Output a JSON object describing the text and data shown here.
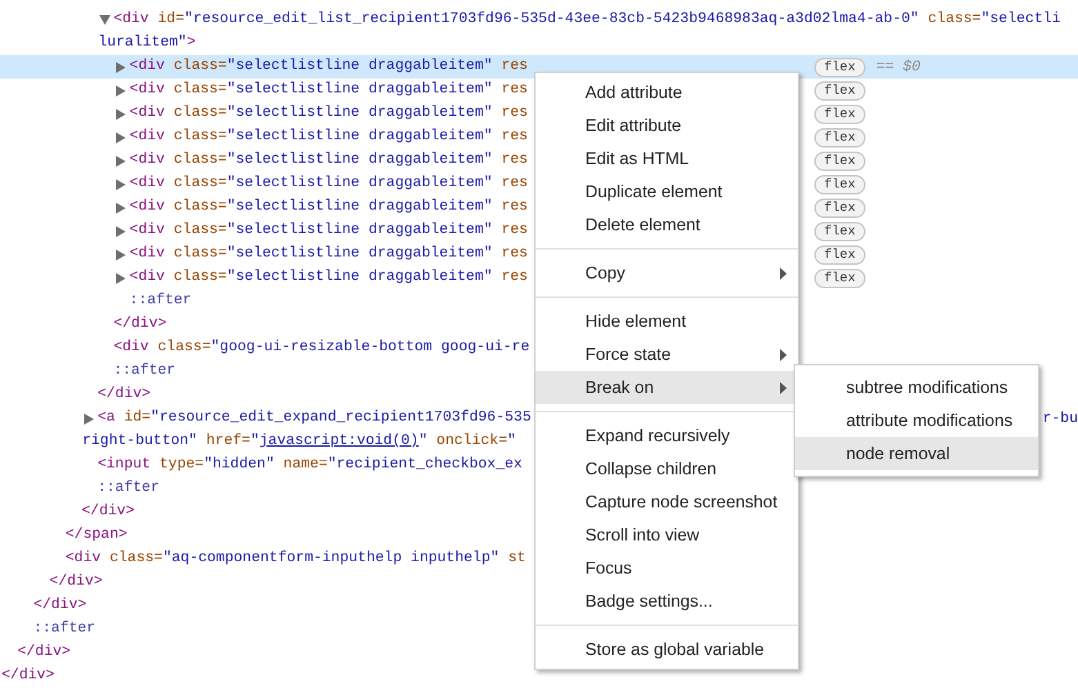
{
  "dom_tree": [
    {
      "children": [
        {
          "children": [
            {
              "children": [
                {
                  "children": [
                    {
                      "children": [
                        {
                          "children": [
                            {
                              "children": [
                                {
                                  "tokens": [
                                    {
                                      "kind": "tag",
                                      "text": "<div"
                                    },
                                    {
                                      "kind": "attr",
                                      "text": " id="
                                    },
                                    {
                                      "kind": "value",
                                      "text": "\"resource_edit_list_recipient1703fd96-535d-43ee-83cb-5423b9468983aq-a3d02lma4-ab-0\""
                                    },
                                    {
                                      "kind": "attr",
                                      "text": " class="
                                    },
                                    {
                                      "kind": "value",
                                      "text": "\"selectli"
                                    }
                                  ],
                                  "wrap": [
                                    {
                                      "kind": "value",
                                      "text": "luralitem\""
                                    },
                                    {
                                      "kind": "tag",
                                      "text": ">"
                                    }
                                  ],
                                  "expanded": true,
                                  "selected": false,
                                  "children": [
                                    {
                                      "tokens": [
                                        {
                                          "kind": "tag",
                                          "text": "<div"
                                        },
                                        {
                                          "kind": "attr",
                                          "text": " class="
                                        },
                                        {
                                          "kind": "value",
                                          "text": "\"selectlistline draggableitem\""
                                        },
                                        {
                                          "kind": "attr",
                                          "text": " res"
                                        }
                                      ],
                                      "expanded": false,
                                      "selected": true,
                                      "badge": "flex",
                                      "console_ref": "== $0"
                                    },
                                    {
                                      "tokens": [
                                        {
                                          "kind": "tag",
                                          "text": "<div"
                                        },
                                        {
                                          "kind": "attr",
                                          "text": " class="
                                        },
                                        {
                                          "kind": "value",
                                          "text": "\"selectlistline draggableitem\""
                                        },
                                        {
                                          "kind": "attr",
                                          "text": " res"
                                        }
                                      ],
                                      "expanded": false,
                                      "selected": false,
                                      "badge": "flex"
                                    },
                                    {
                                      "tokens": [
                                        {
                                          "kind": "tag",
                                          "text": "<div"
                                        },
                                        {
                                          "kind": "attr",
                                          "text": " class="
                                        },
                                        {
                                          "kind": "value",
                                          "text": "\"selectlistline draggableitem\""
                                        },
                                        {
                                          "kind": "attr",
                                          "text": " res"
                                        }
                                      ],
                                      "expanded": false,
                                      "selected": false,
                                      "badge": "flex"
                                    },
                                    {
                                      "tokens": [
                                        {
                                          "kind": "tag",
                                          "text": "<div"
                                        },
                                        {
                                          "kind": "attr",
                                          "text": " class="
                                        },
                                        {
                                          "kind": "value",
                                          "text": "\"selectlistline draggableitem\""
                                        },
                                        {
                                          "kind": "attr",
                                          "text": " res"
                                        }
                                      ],
                                      "expanded": false,
                                      "selected": false,
                                      "badge": "flex"
                                    },
                                    {
                                      "tokens": [
                                        {
                                          "kind": "tag",
                                          "text": "<div"
                                        },
                                        {
                                          "kind": "attr",
                                          "text": " class="
                                        },
                                        {
                                          "kind": "value",
                                          "text": "\"selectlistline draggableitem\""
                                        },
                                        {
                                          "kind": "attr",
                                          "text": " res"
                                        }
                                      ],
                                      "expanded": false,
                                      "selected": false,
                                      "badge": "flex"
                                    },
                                    {
                                      "tokens": [
                                        {
                                          "kind": "tag",
                                          "text": "<div"
                                        },
                                        {
                                          "kind": "attr",
                                          "text": " class="
                                        },
                                        {
                                          "kind": "value",
                                          "text": "\"selectlistline draggableitem\""
                                        },
                                        {
                                          "kind": "attr",
                                          "text": " res"
                                        }
                                      ],
                                      "expanded": false,
                                      "selected": false,
                                      "badge": "flex"
                                    },
                                    {
                                      "tokens": [
                                        {
                                          "kind": "tag",
                                          "text": "<div"
                                        },
                                        {
                                          "kind": "attr",
                                          "text": " class="
                                        },
                                        {
                                          "kind": "value",
                                          "text": "\"selectlistline draggableitem\""
                                        },
                                        {
                                          "kind": "attr",
                                          "text": " res"
                                        }
                                      ],
                                      "expanded": false,
                                      "selected": false,
                                      "badge": "flex"
                                    },
                                    {
                                      "tokens": [
                                        {
                                          "kind": "tag",
                                          "text": "<div"
                                        },
                                        {
                                          "kind": "attr",
                                          "text": " class="
                                        },
                                        {
                                          "kind": "value",
                                          "text": "\"selectlistline draggableitem\""
                                        },
                                        {
                                          "kind": "attr",
                                          "text": " res"
                                        }
                                      ],
                                      "expanded": false,
                                      "selected": false,
                                      "badge": "flex"
                                    },
                                    {
                                      "tokens": [
                                        {
                                          "kind": "tag",
                                          "text": "<div"
                                        },
                                        {
                                          "kind": "attr",
                                          "text": " class="
                                        },
                                        {
                                          "kind": "value",
                                          "text": "\"selectlistline draggableitem\""
                                        },
                                        {
                                          "kind": "attr",
                                          "text": " res"
                                        }
                                      ],
                                      "expanded": false,
                                      "selected": false,
                                      "badge": "flex"
                                    },
                                    {
                                      "tokens": [
                                        {
                                          "kind": "tag",
                                          "text": "<div"
                                        },
                                        {
                                          "kind": "attr",
                                          "text": " class="
                                        },
                                        {
                                          "kind": "value",
                                          "text": "\"selectlistline draggableitem\""
                                        },
                                        {
                                          "kind": "attr",
                                          "text": " res"
                                        }
                                      ],
                                      "expanded": false,
                                      "selected": false,
                                      "badge": "flex"
                                    },
                                    {
                                      "tokens": [
                                        {
                                          "kind": "pseudo",
                                          "text": "::after"
                                        }
                                      ],
                                      "selected": false
                                    }
                                  ]
                                },
                                {
                                  "tokens": [
                                    {
                                      "kind": "tag",
                                      "text": "</div>"
                                    }
                                  ],
                                  "selected": false
                                },
                                {
                                  "tokens": [
                                    {
                                      "kind": "tag",
                                      "text": "<div"
                                    },
                                    {
                                      "kind": "attr",
                                      "text": " class="
                                    },
                                    {
                                      "kind": "value",
                                      "text": "\"goog-ui-resizable-bottom goog-ui-re"
                                    }
                                  ],
                                  "selected": false
                                },
                                {
                                  "tokens": [
                                    {
                                      "kind": "pseudo",
                                      "text": "::after"
                                    }
                                  ],
                                  "selected": false
                                }
                              ]
                            },
                            {
                              "tokens": [
                                {
                                  "kind": "tag",
                                  "text": "</div>"
                                }
                              ],
                              "selected": false
                            },
                            {
                              "tokens": [
                                {
                                  "kind": "tag",
                                  "text": "<a"
                                },
                                {
                                  "kind": "attr",
                                  "text": " id="
                                },
                                {
                                  "kind": "value",
                                  "text": "\"resource_edit_expand_recipient1703fd96-535"
                                }
                              ],
                              "tail": [
                                {
                                  "kind": "value",
                                  "text": "r-bu"
                                }
                              ],
                              "wrap": [
                                {
                                  "kind": "value",
                                  "text": "right-button\""
                                },
                                {
                                  "kind": "attr",
                                  "text": " href="
                                },
                                {
                                  "kind": "value",
                                  "text": "\""
                                },
                                {
                                  "kind": "link",
                                  "text": "javascript:void(0)"
                                },
                                {
                                  "kind": "value",
                                  "text": "\""
                                },
                                {
                                  "kind": "attr",
                                  "text": " onclick="
                                },
                                {
                                  "kind": "value",
                                  "text": "\""
                                }
                              ],
                              "expanded": false,
                              "selected": false
                            },
                            {
                              "tokens": [
                                {
                                  "kind": "tag",
                                  "text": "<input"
                                },
                                {
                                  "kind": "attr",
                                  "text": " type="
                                },
                                {
                                  "kind": "value",
                                  "text": "\"hidden\""
                                },
                                {
                                  "kind": "attr",
                                  "text": " name="
                                },
                                {
                                  "kind": "value",
                                  "text": "\"recipient_checkbox_ex"
                                }
                              ],
                              "selected": false
                            },
                            {
                              "tokens": [
                                {
                                  "kind": "pseudo",
                                  "text": "::after"
                                }
                              ],
                              "selected": false
                            }
                          ]
                        },
                        {
                          "tokens": [
                            {
                              "kind": "tag",
                              "text": "</div>"
                            }
                          ],
                          "selected": false
                        }
                      ]
                    },
                    {
                      "tokens": [
                        {
                          "kind": "tag",
                          "text": "</span>"
                        }
                      ],
                      "selected": false
                    },
                    {
                      "tokens": [
                        {
                          "kind": "tag",
                          "text": "<div"
                        },
                        {
                          "kind": "attr",
                          "text": " class="
                        },
                        {
                          "kind": "value",
                          "text": "\"aq-componentform-inputhelp inputhelp\""
                        },
                        {
                          "kind": "attr",
                          "text": " st"
                        }
                      ],
                      "selected": false
                    }
                  ]
                },
                {
                  "tokens": [
                    {
                      "kind": "tag",
                      "text": "</div>"
                    }
                  ],
                  "selected": false
                }
              ]
            },
            {
              "tokens": [
                {
                  "kind": "tag",
                  "text": "</div>"
                }
              ],
              "selected": false
            },
            {
              "tokens": [
                {
                  "kind": "pseudo",
                  "text": "::after"
                }
              ],
              "selected": false
            }
          ]
        },
        {
          "tokens": [
            {
              "kind": "tag",
              "text": "</div>"
            }
          ],
          "selected": false
        }
      ]
    },
    {
      "tokens": [
        {
          "kind": "tag",
          "text": "</div>"
        }
      ],
      "selected": false
    }
  ],
  "context_menu": {
    "items": [
      {
        "kind": "item",
        "label": "Add attribute",
        "submenu": false,
        "highlighted": false
      },
      {
        "kind": "item",
        "label": "Edit attribute",
        "submenu": false,
        "highlighted": false
      },
      {
        "kind": "item",
        "label": "Edit as HTML",
        "submenu": false,
        "highlighted": false
      },
      {
        "kind": "item",
        "label": "Duplicate element",
        "submenu": false,
        "highlighted": false
      },
      {
        "kind": "item",
        "label": "Delete element",
        "submenu": false,
        "highlighted": false
      },
      {
        "kind": "separator"
      },
      {
        "kind": "item",
        "label": "Copy",
        "submenu": true,
        "highlighted": false
      },
      {
        "kind": "separator"
      },
      {
        "kind": "item",
        "label": "Hide element",
        "submenu": false,
        "highlighted": false
      },
      {
        "kind": "item",
        "label": "Force state",
        "submenu": true,
        "highlighted": false
      },
      {
        "kind": "item",
        "label": "Break on",
        "submenu": true,
        "highlighted": true
      },
      {
        "kind": "separator"
      },
      {
        "kind": "item",
        "label": "Expand recursively",
        "submenu": false,
        "highlighted": false
      },
      {
        "kind": "item",
        "label": "Collapse children",
        "submenu": false,
        "highlighted": false
      },
      {
        "kind": "item",
        "label": "Capture node screenshot",
        "submenu": false,
        "highlighted": false
      },
      {
        "kind": "item",
        "label": "Scroll into view",
        "submenu": false,
        "highlighted": false
      },
      {
        "kind": "item",
        "label": "Focus",
        "submenu": false,
        "highlighted": false
      },
      {
        "kind": "item",
        "label": "Badge settings...",
        "submenu": false,
        "highlighted": false
      },
      {
        "kind": "separator"
      },
      {
        "kind": "item",
        "label": "Store as global variable",
        "submenu": false,
        "highlighted": false
      }
    ]
  },
  "submenu": {
    "items": [
      {
        "kind": "item",
        "label": "subtree modifications",
        "submenu": false,
        "highlighted": false
      },
      {
        "kind": "item",
        "label": "attribute modifications",
        "submenu": false,
        "highlighted": false
      },
      {
        "kind": "item",
        "label": "node removal",
        "submenu": false,
        "highlighted": true
      }
    ]
  }
}
